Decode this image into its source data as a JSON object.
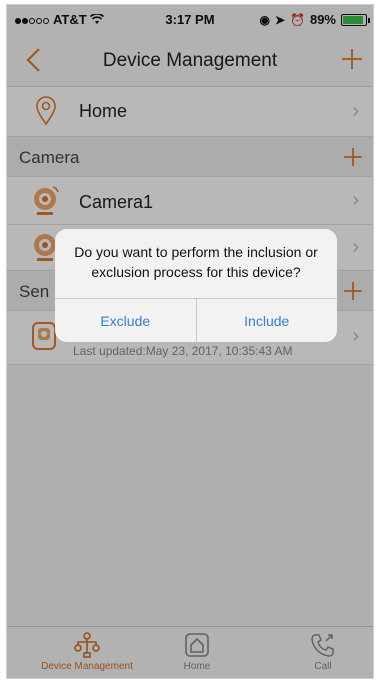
{
  "status_bar": {
    "carrier": "AT&T",
    "time": "3:17 PM",
    "battery": "89%",
    "battery_fill": 0.89
  },
  "nav": {
    "back_icon": "chevron-left-icon",
    "title": "Device Management",
    "add_icon": "plus-icon"
  },
  "home_row": {
    "label": "Home"
  },
  "camera_section": {
    "label": "Camera"
  },
  "cameras": [
    {
      "label": "Camera1"
    },
    {
      "label": ""
    }
  ],
  "sensor_section": {
    "label": "Sen"
  },
  "sensors": [
    {
      "label": "",
      "last_updated": "Last updated:May 23, 2017, 10:35:43 AM"
    }
  ],
  "dialog": {
    "message": "Do you want to perform the inclusion or exclusion process for this device?",
    "exclude_label": "Exclude",
    "include_label": "Include"
  },
  "tabbar": {
    "tabs": [
      {
        "label": "Device Management",
        "icon": "network-icon",
        "active": true
      },
      {
        "label": "Home",
        "icon": "home-icon",
        "active": false
      },
      {
        "label": "Call",
        "icon": "phone-icon",
        "active": false
      }
    ]
  },
  "colors": {
    "accent": "#e07a24",
    "link": "#3a7be0"
  }
}
